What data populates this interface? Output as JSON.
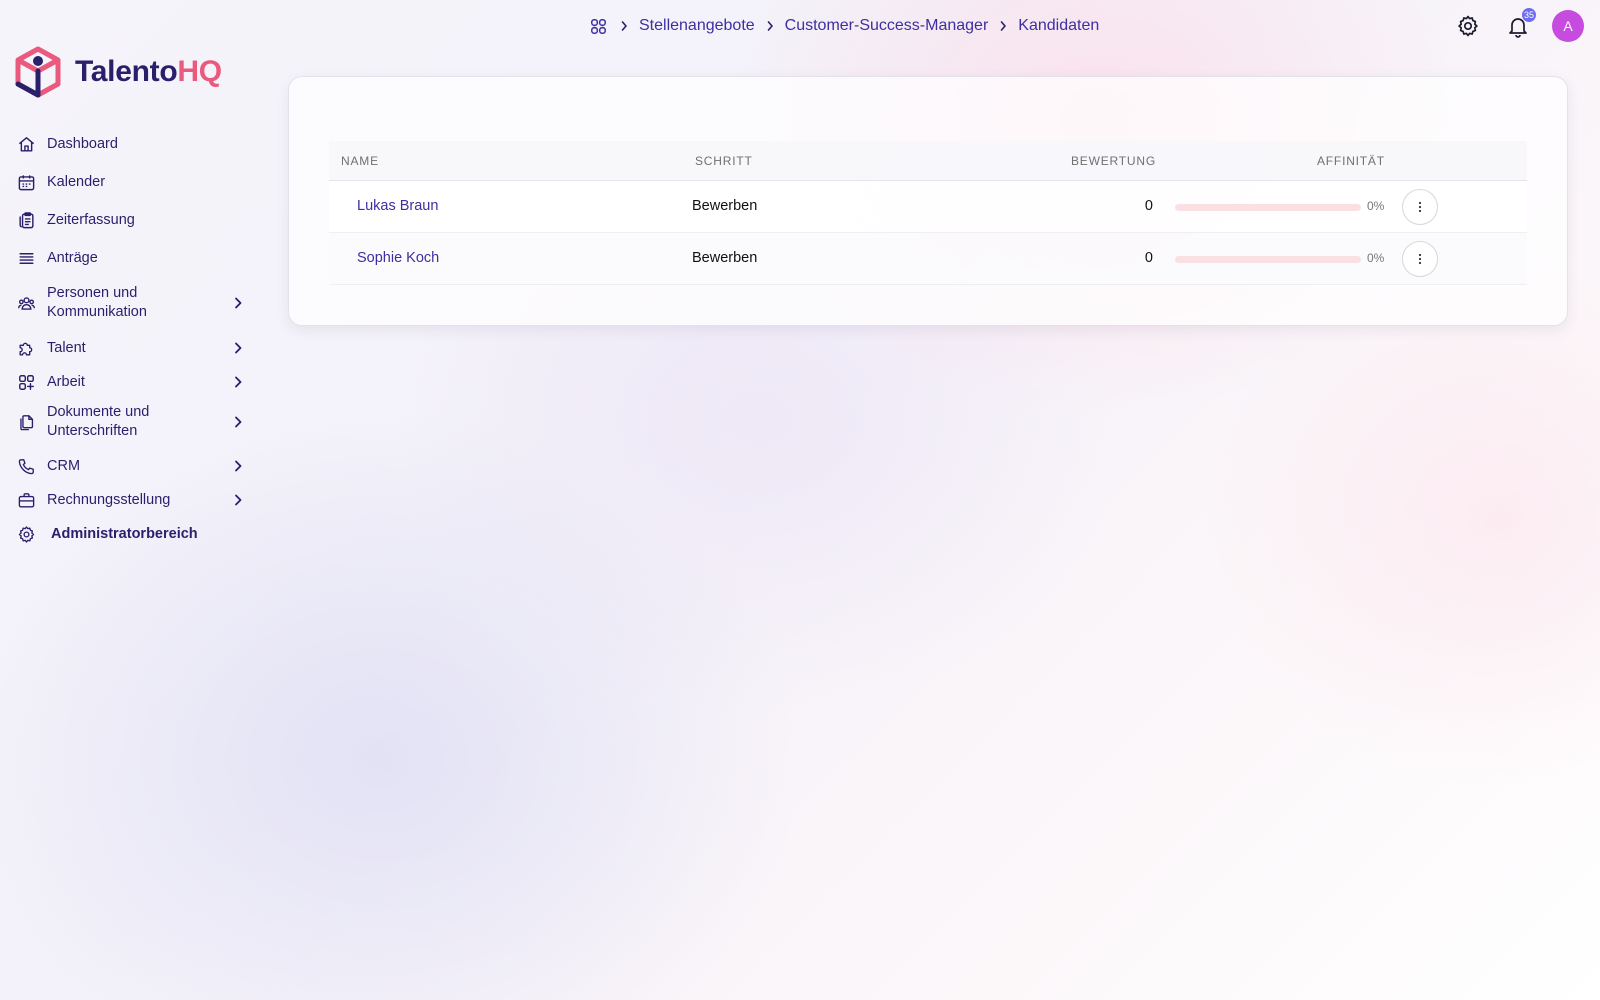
{
  "brand": {
    "name_part1": "Talento",
    "name_part2": "HQ",
    "accent_pink": "#ea5a7e",
    "accent_navy": "#2a1f6b",
    "accent_indigo": "#3d2fa0"
  },
  "breadcrumb": {
    "home_icon": "grid-icon",
    "items": [
      "Stellenangebote",
      "Customer-Success-Manager",
      "Kandidaten"
    ]
  },
  "topbar": {
    "settings_icon": "gear-icon",
    "notifications_icon": "bell-icon",
    "notifications_count": "35",
    "avatar_initial": "A"
  },
  "sidebar": {
    "items": [
      {
        "label": "Dashboard",
        "icon": "home-icon"
      },
      {
        "label": "Kalender",
        "icon": "calendar-icon"
      },
      {
        "label": "Zeiterfassung",
        "icon": "clipboard-icon"
      },
      {
        "label": "Anträge",
        "icon": "list-icon"
      },
      {
        "label": "Personen und Kommunikation",
        "icon": "people-icon",
        "expandable": true
      },
      {
        "label": "Talent",
        "icon": "puzzle-icon",
        "expandable": true
      },
      {
        "label": "Arbeit",
        "icon": "apps-icon",
        "expandable": true
      },
      {
        "label": "Dokumente und Unterschriften",
        "icon": "documents-icon",
        "expandable": true
      },
      {
        "label": "CRM",
        "icon": "phone-icon",
        "expandable": true
      },
      {
        "label": "Rechnungsstellung",
        "icon": "briefcase-icon",
        "expandable": true
      },
      {
        "label": "Administratorbereich",
        "icon": "gear-icon"
      }
    ]
  },
  "table": {
    "headers": {
      "name": "Name",
      "step": "Schritt",
      "rating": "Bewertung",
      "affinity": "Affinität"
    },
    "rows": [
      {
        "name": "Lukas Braun",
        "step": "Bewerben",
        "rating": "0",
        "affinity_percent": 0,
        "affinity_label": "0%"
      },
      {
        "name": "Sophie Koch",
        "step": "Bewerben",
        "rating": "0",
        "affinity_percent": 0,
        "affinity_label": "0%"
      }
    ]
  }
}
